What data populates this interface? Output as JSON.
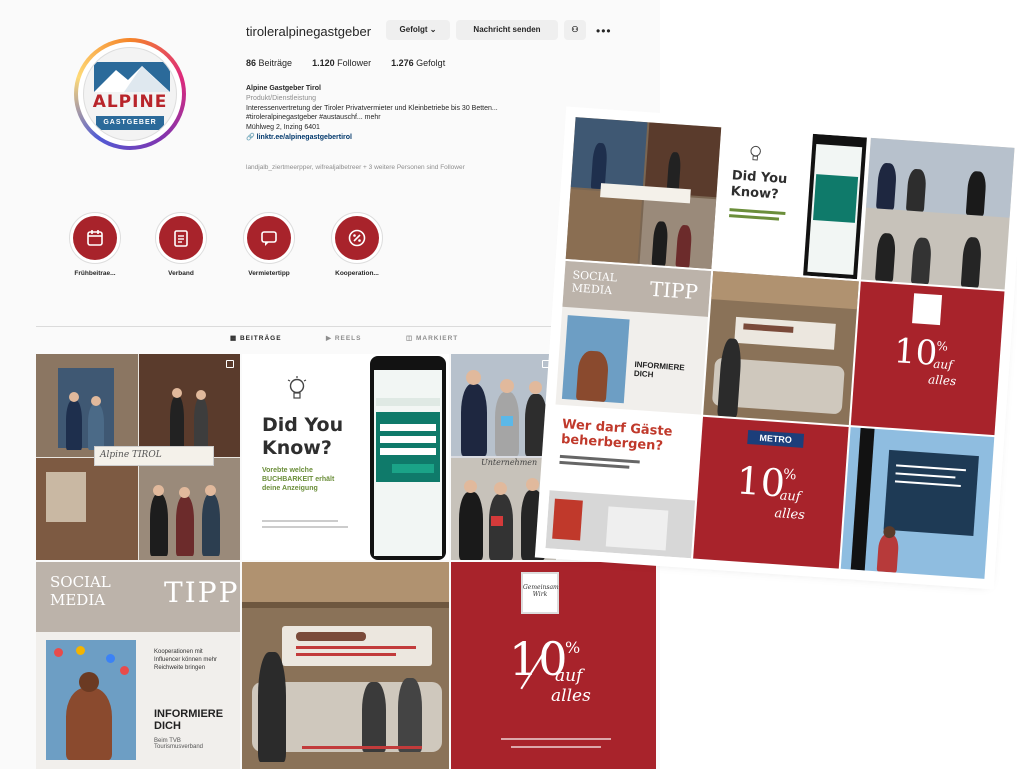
{
  "profile": {
    "username": "tiroleralpinegastgeber",
    "following_button": "Gefolgt",
    "message_button": "Nachricht senden",
    "more_icon": "more-dots-icon",
    "stats": {
      "posts_value": "86",
      "posts_label": "Beiträge",
      "followers_value": "1.120",
      "followers_label": "Follower",
      "following_value": "1.276",
      "following_label": "Gefolgt"
    },
    "bio": {
      "name": "Alpine Gastgeber Tirol",
      "category": "Produkt/Dienstleistung",
      "line1": "Interessenvertretung der Tiroler Privatvermieter und Kleinbetriebe bis 30 Betten...",
      "line2": "#tiroleralpinegastgeber #austauschf... mehr",
      "line3": "Mühlweg 2, Inzing 6401",
      "link": "linktr.ee/alpinegastgebertirol"
    },
    "followed_by": "landjalb_ziertmeerpper, wifrealjalbetreer + 3 weitere Personen sind Follower"
  },
  "logo": {
    "word": "ALPINE",
    "sub": "GASTGEBER"
  },
  "highlights": [
    {
      "label": "Frühbeitrae...",
      "icon": "calendar-icon"
    },
    {
      "label": "Verband",
      "icon": "document-icon"
    },
    {
      "label": "Vermietertipp",
      "icon": "chat-icon"
    },
    {
      "label": "Kooperation...",
      "icon": "percent-icon"
    }
  ],
  "tabs": [
    "BEITRÄGE",
    "REELS",
    "MARKIERT"
  ],
  "posts": {
    "dyk_title": "Did You Know?",
    "dyk_body": "Vorebte welche BUCHBARKEIT erhält deine Anzeigung",
    "social": "SOCIAL",
    "media": "MEDIA",
    "tipp": "TIPP",
    "informiere": "INFORMIERE DICH",
    "ten": "10",
    "percent": "%",
    "auf": "auf",
    "alles": "alles",
    "wer_darf": "Wer darf Gäste beherbergen?",
    "metro": "METRO",
    "steckbrief": "Alpine TIROL"
  },
  "colors": {
    "brand_red": "#a8232b",
    "accent_blue": "#2b6a9a"
  }
}
